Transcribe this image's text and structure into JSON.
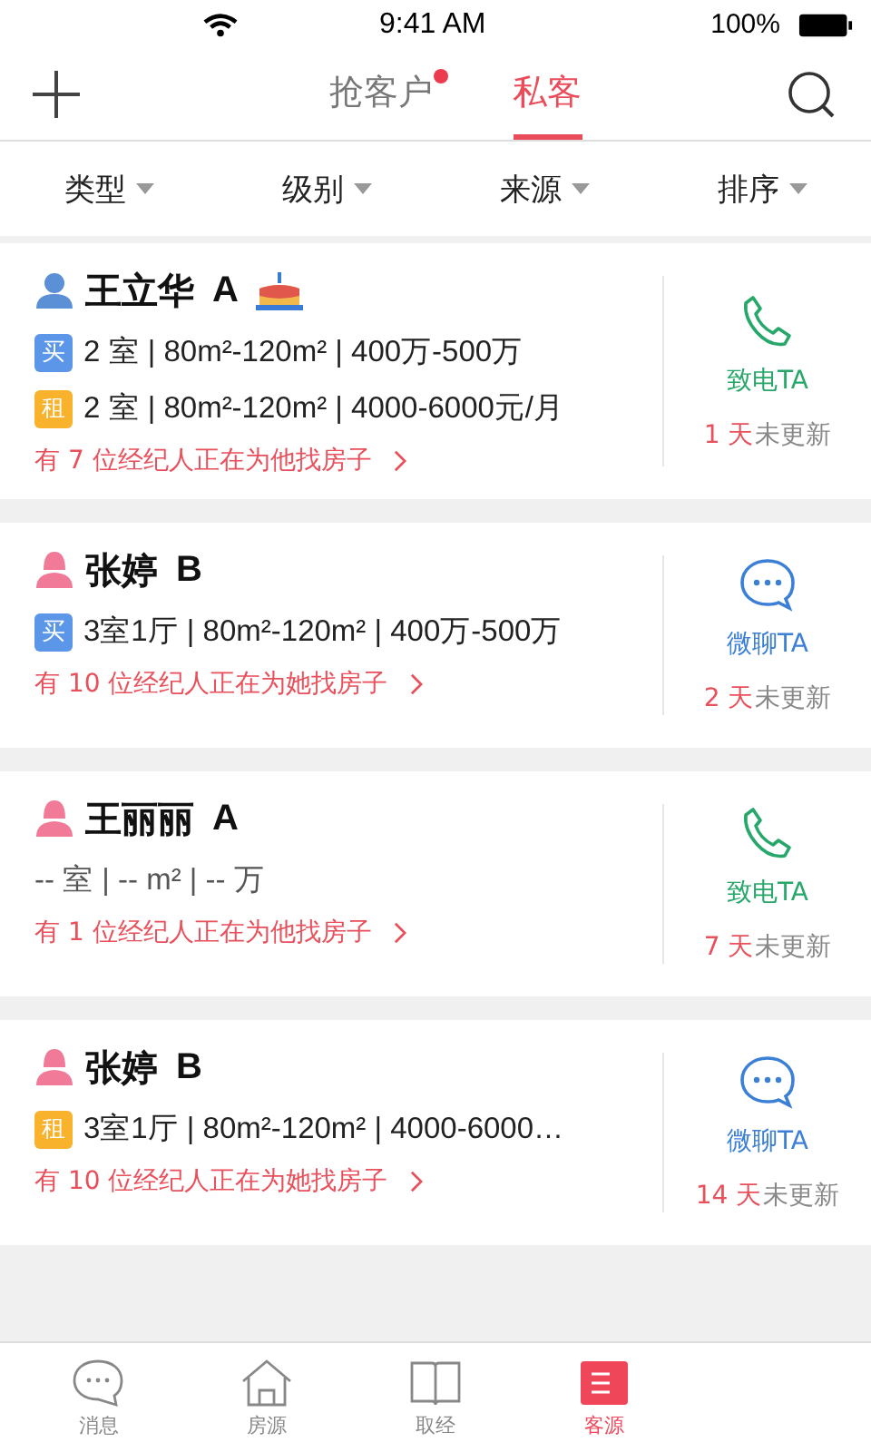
{
  "status_bar": {
    "time": "9:41 AM",
    "battery": "100%"
  },
  "header": {
    "tabs": [
      {
        "label": "抢客户",
        "selected": false,
        "badge": true
      },
      {
        "label": "私客",
        "selected": true,
        "badge": false
      }
    ]
  },
  "filters": [
    {
      "label": "类型"
    },
    {
      "label": "级别"
    },
    {
      "label": "来源"
    },
    {
      "label": "排序"
    }
  ],
  "customers": [
    {
      "name": "王立华",
      "grade": "A",
      "kind": "male",
      "birthday": true,
      "demands": [
        {
          "tag": "买",
          "kind": "buy",
          "text": "2 室 | 80m²-120m² | 400万-500万"
        },
        {
          "tag": "租",
          "kind": "rent",
          "text": "2 室 | 80m²-120m² | 4000-6000元/月"
        }
      ],
      "agents": "有 7 位经纪人正在为他找房子",
      "action": {
        "kind": "call",
        "label": "致电TA"
      },
      "days": "1 天",
      "status": "未更新"
    },
    {
      "name": "张婷",
      "grade": "B",
      "kind": "female",
      "birthday": false,
      "demands": [
        {
          "tag": "买",
          "kind": "buy",
          "text": "3室1厅 | 80m²-120m² | 400万-500万"
        }
      ],
      "agents": "有 10 位经纪人正在为她找房子",
      "action": {
        "kind": "chat",
        "label": "微聊TA"
      },
      "days": "2 天",
      "status": "未更新"
    },
    {
      "name": "王丽丽",
      "grade": "A",
      "kind": "female",
      "birthday": false,
      "demands": [
        {
          "kind": "empty",
          "text": "-- 室 | -- m² | -- 万"
        }
      ],
      "agents": "有 1 位经纪人正在为他找房子",
      "action": {
        "kind": "call",
        "label": "致电TA"
      },
      "days": "7 天",
      "status": "未更新"
    },
    {
      "name": "张婷",
      "grade": "B",
      "kind": "female",
      "birthday": false,
      "demands": [
        {
          "tag": "租",
          "kind": "rent",
          "text": "3室1厅 | 80m²-120m² | 4000-6000…"
        }
      ],
      "agents": "有 10 位经纪人正在为她找房子",
      "action": {
        "kind": "chat",
        "label": "微聊TA"
      },
      "days": "14 天",
      "status": "未更新"
    }
  ],
  "tab_bar": [
    {
      "label": "消息",
      "selected": false
    },
    {
      "label": "房源",
      "selected": false
    },
    {
      "label": "取经",
      "selected": false
    },
    {
      "label": "客源",
      "selected": true
    }
  ]
}
